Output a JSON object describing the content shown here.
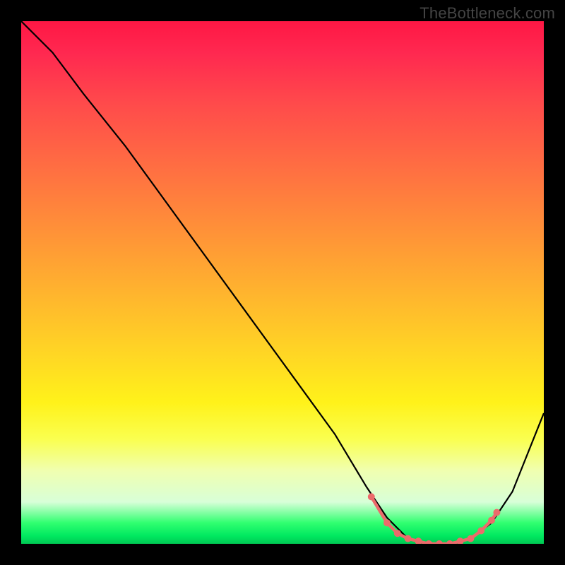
{
  "watermark": "TheBottleneck.com",
  "chart_data": {
    "type": "line",
    "title": "",
    "xlabel": "",
    "ylabel": "",
    "xlim": [
      0,
      100
    ],
    "ylim": [
      0,
      100
    ],
    "series": [
      {
        "name": "bottleneck-curve",
        "x": [
          0,
          6,
          12,
          20,
          28,
          36,
          44,
          52,
          60,
          66,
          70,
          74,
          78,
          82,
          86,
          90,
          94,
          100
        ],
        "y": [
          100,
          94,
          86,
          76,
          65,
          54,
          43,
          32,
          21,
          11,
          5,
          1,
          0,
          0,
          1,
          4,
          10,
          25
        ]
      }
    ],
    "highlight_points": {
      "name": "optimal-range-dots",
      "x": [
        67,
        70,
        72,
        74,
        76,
        78,
        80,
        82,
        84,
        86,
        88,
        90,
        91
      ],
      "y": [
        9,
        4,
        2,
        1,
        0.5,
        0,
        0,
        0,
        0.5,
        1,
        2.5,
        4.5,
        6
      ]
    }
  }
}
